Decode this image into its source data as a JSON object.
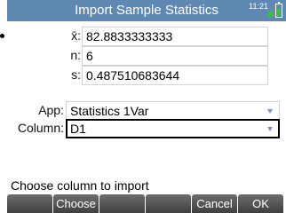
{
  "window": {
    "title": "Import Sample Statistics",
    "clock": "11:21"
  },
  "stats": [
    {
      "label": "x̄:",
      "value": "82.8833333333"
    },
    {
      "label": "n:",
      "value": "6"
    },
    {
      "label": "s:",
      "value": "0.487510683644"
    }
  ],
  "form": {
    "app_label": "App:",
    "app_value": "Statistics 1Var",
    "column_label": "Column:",
    "column_value": "D1"
  },
  "status": {
    "hint": "Choose column to import"
  },
  "menu": [
    {
      "label": ""
    },
    {
      "label": "Choose"
    },
    {
      "label": ""
    },
    {
      "label": ""
    },
    {
      "label": "Cancel"
    },
    {
      "label": "OK"
    }
  ],
  "colors": {
    "title_bar": "#5f88b2",
    "dropdown_arrow": "#7b93c1",
    "battery": "#3fbf3f"
  }
}
